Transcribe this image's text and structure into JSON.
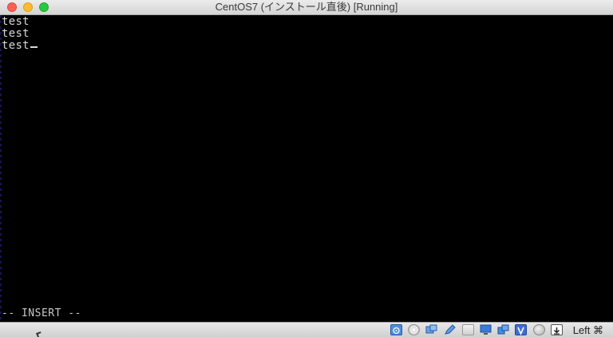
{
  "window": {
    "title": "CentOS7 (インストール直後) [Running]"
  },
  "terminal": {
    "lines": [
      "test",
      "test",
      "test"
    ],
    "mode_indicator": "-- INSERT --",
    "cursor_line": 3
  },
  "statusbar": {
    "icons": [
      "hard-disk-icon",
      "optical-drive-icon",
      "usb-icon",
      "shared-folders-icon",
      "display-icon",
      "network-icon",
      "video-capture-icon",
      "virtualization-icon",
      "mouse-integration-icon",
      "keyboard-capture-icon"
    ],
    "host_key": "Left ⌘"
  },
  "colors": {
    "screen_bg": "#000000",
    "text": "#d8d8d8",
    "titlebar": "#e0e0e0",
    "close": "#fc5f57",
    "minimize": "#fdbc2e",
    "maximize": "#28c840",
    "icon_accent": "#3a7bd5"
  }
}
